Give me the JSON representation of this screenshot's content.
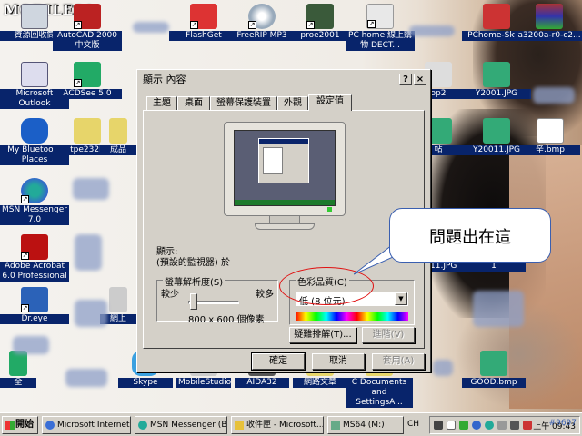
{
  "desktop": {
    "logo": "MOBILE01",
    "icons": [
      {
        "label": "資源回收筒"
      },
      {
        "label": "AutoCAD 2000 中文版"
      },
      {
        "label": "FlashGet"
      },
      {
        "label": "FreeRIP MP3"
      },
      {
        "label": "proe2001"
      },
      {
        "label": "PC home 線上購物 DECT..."
      },
      {
        "label": "PChome-Sky..."
      },
      {
        "label": "a3200a-r0-c2..."
      },
      {
        "label": "Microsoft Outlook"
      },
      {
        "label": "ACDSee 5.0"
      },
      {
        "label": "op2"
      },
      {
        "label": "Y2001.JPG"
      },
      {
        "label": "My Bluetooth Places"
      },
      {
        "label": "tpe232h"
      },
      {
        "label": "成品"
      },
      {
        "label": "帖"
      },
      {
        "label": "Y20011.JPG"
      },
      {
        "label": "辛.bmp"
      },
      {
        "label": "MSN Messenger 7.0"
      },
      {
        "label": "Adobe Acrobat 6.0 Professional"
      },
      {
        "label": "1111.JPG"
      },
      {
        "label": "1"
      },
      {
        "label": "Dr.eye"
      },
      {
        "label": "網上"
      },
      {
        "label": "Skype"
      },
      {
        "label": "MobileStudio"
      },
      {
        "label": "AIDA32"
      },
      {
        "label": "網路文章"
      },
      {
        "label": "C Documents and SettingsA..."
      },
      {
        "label": "GOOD.bmp"
      },
      {
        "label": "全"
      }
    ]
  },
  "dialog": {
    "title": "顯示 內容",
    "help_glyph": "?",
    "close_glyph": "×",
    "tabs": [
      "主題",
      "桌面",
      "螢幕保護裝置",
      "外觀",
      "設定值"
    ],
    "active_tab": "設定值",
    "display_label": "顯示:",
    "display_value": "(預設的監視器) 於",
    "resolution": {
      "legend": "螢幕解析度(S)",
      "less": "較少",
      "more": "較多",
      "value": "800 x 600 個像素",
      "slider_fraction": 0.0
    },
    "color_quality": {
      "legend": "色彩品質(C)",
      "selected": "低 (8 位元)"
    },
    "troubleshoot_button": "疑難排解(T)...",
    "advanced_button": "進階(V)",
    "ok_button": "確定",
    "cancel_button": "取消",
    "apply_button": "套用(A)"
  },
  "annotation": {
    "callout_text": "問題出在這",
    "ellipse_color": "#e01010"
  },
  "taskbar": {
    "start_label": "開始",
    "tasks": [
      {
        "label": "Microsoft Internet ..."
      },
      {
        "label": "MSN Messenger (B..."
      },
      {
        "label": "收件匣 - Microsoft..."
      },
      {
        "label": "MS64 (M:)"
      }
    ],
    "ime_label": "CH",
    "clock": "上午 09:43"
  },
  "watermark": "#9697",
  "colors": {
    "title_bar": "#d4d0c8",
    "selection": "#08246b",
    "callout_border": "#3a5fb0"
  }
}
